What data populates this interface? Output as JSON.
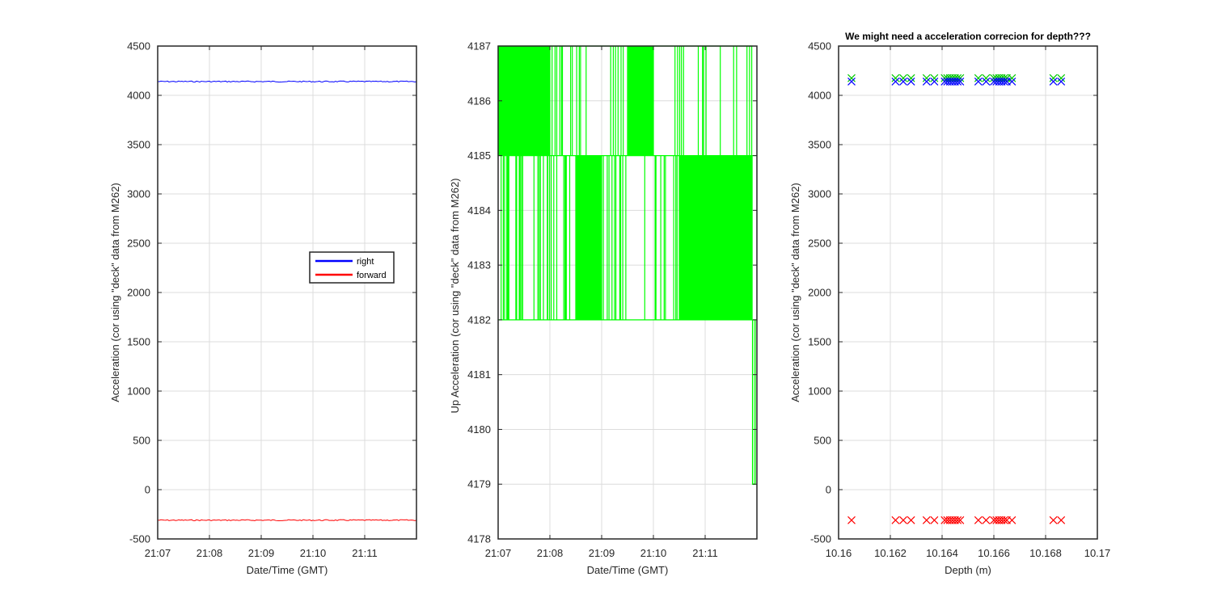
{
  "chart_data": [
    {
      "type": "line",
      "title": "",
      "xlabel": "Date/Time (GMT)",
      "ylabel": "Acceleration (cor using \"deck\" data from M262)",
      "xlim": [
        "21:07",
        "21:12"
      ],
      "ylim": [
        -500,
        4500
      ],
      "x_ticks": [
        "21:07",
        "21:08",
        "21:09",
        "21:10",
        "21:11"
      ],
      "y_ticks": [
        -500,
        0,
        500,
        1000,
        1500,
        2000,
        2500,
        3000,
        3500,
        4000,
        4500
      ],
      "grid": true,
      "legend": {
        "position": "right-middle",
        "entries": [
          "right",
          "forward"
        ]
      },
      "series": [
        {
          "name": "right",
          "color": "#0000ff",
          "x": [
            "21:07",
            "21:12"
          ],
          "y": [
            4140,
            4140
          ]
        },
        {
          "name": "forward",
          "color": "#ff0000",
          "x": [
            "21:07",
            "21:12"
          ],
          "y": [
            -310,
            -310
          ]
        }
      ]
    },
    {
      "type": "line",
      "title": "",
      "xlabel": "Date/Time (GMT)",
      "ylabel": "Up Acceleration (cor using \"deck\" data from M262)",
      "xlim": [
        "21:07",
        "21:12"
      ],
      "ylim": [
        4178,
        4187
      ],
      "x_ticks": [
        "21:07",
        "21:08",
        "21:09",
        "21:10",
        "21:11"
      ],
      "y_ticks": [
        4178,
        4179,
        4180,
        4181,
        4182,
        4183,
        4184,
        4185,
        4186,
        4187
      ],
      "grid": true,
      "series": [
        {
          "color": "#00ff00",
          "description_levels": [
            4182,
            4185,
            4187
          ],
          "upper_band": [
            4185,
            4187
          ],
          "lower_band": [
            4182,
            4185
          ],
          "upper_band_dense_ranges": [
            [
              "21:07",
              "21:08"
            ],
            [
              "21:09:30",
              "21:10:00"
            ]
          ],
          "lower_band_dense_ranges": [
            [
              "21:08:30",
              "21:09:00"
            ],
            [
              "21:10:30",
              "21:12"
            ]
          ],
          "final_dip": {
            "x": "21:11:55",
            "y": 4179
          }
        }
      ]
    },
    {
      "type": "scatter",
      "title": "We might need a acceleration correcion for depth???",
      "xlabel": "Depth (m)",
      "ylabel": "Acceleration (cor using \"deck\" data from M262)",
      "xlim": [
        10.16,
        10.17
      ],
      "ylim": [
        -500,
        4500
      ],
      "x_ticks": [
        "10.16",
        "10.162",
        "10.164",
        "10.166",
        "10.168",
        "10.17"
      ],
      "y_ticks": [
        -500,
        0,
        500,
        1000,
        1500,
        2000,
        2500,
        3000,
        3500,
        4000,
        4500
      ],
      "grid": true,
      "marker": "x",
      "depth_x": [
        10.1605,
        10.1622,
        10.1625,
        10.1628,
        10.1634,
        10.1637,
        10.1641,
        10.1642,
        10.1643,
        10.1644,
        10.1645,
        10.1646,
        10.1647,
        10.1654,
        10.1657,
        10.166,
        10.1661,
        10.1662,
        10.1663,
        10.1664,
        10.1665,
        10.1667,
        10.1683,
        10.1686
      ],
      "series": [
        {
          "color": "#00c800",
          "y": 4175
        },
        {
          "color": "#0000ff",
          "y": 4140
        },
        {
          "color": "#ff0000",
          "y": -310
        }
      ]
    }
  ]
}
